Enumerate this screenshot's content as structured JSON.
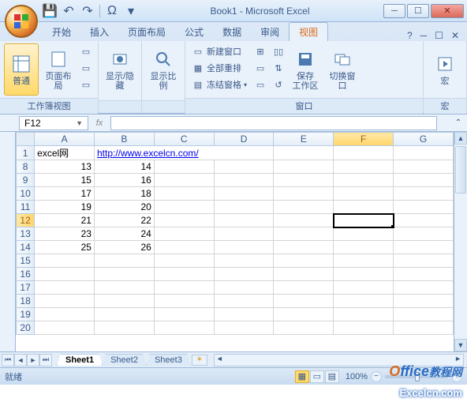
{
  "window": {
    "title": "Book1 - Microsoft Excel"
  },
  "qat": {
    "save": "💾",
    "undo": "↶",
    "redo": "↷",
    "omega": "Ω"
  },
  "tabs": {
    "items": [
      "开始",
      "插入",
      "页面布局",
      "公式",
      "数据",
      "审阅",
      "视图"
    ],
    "active": 6,
    "help": "?"
  },
  "ribbon": {
    "group1_label": "工作簿视图",
    "group2_label": "窗口",
    "group3_label": "宏",
    "normal": "普通",
    "page_layout": "页面布局",
    "show_hide": "显示/隐藏",
    "zoom": "显示比例",
    "new_window": "新建窗口",
    "arrange_all": "全部重排",
    "freeze": "冻结窗格",
    "save_workspace": "保存\n工作区",
    "switch_window": "切换窗口",
    "macros": "宏"
  },
  "namebox": "F12",
  "columns": [
    "A",
    "B",
    "C",
    "D",
    "E",
    "F",
    "G"
  ],
  "rows": [
    {
      "h": "1",
      "cells": [
        "excel网",
        "http://www.excelcn.com/",
        "",
        "",
        "",
        "",
        ""
      ],
      "text": [
        0
      ],
      "link": [
        1
      ],
      "linkspan": 3
    },
    {
      "h": "8",
      "cells": [
        "13",
        "14",
        "",
        "",
        "",
        "",
        ""
      ]
    },
    {
      "h": "9",
      "cells": [
        "15",
        "16",
        "",
        "",
        "",
        "",
        ""
      ]
    },
    {
      "h": "10",
      "cells": [
        "17",
        "18",
        "",
        "",
        "",
        "",
        ""
      ]
    },
    {
      "h": "11",
      "cells": [
        "19",
        "20",
        "",
        "",
        "",
        "",
        ""
      ]
    },
    {
      "h": "12",
      "cells": [
        "21",
        "22",
        "",
        "",
        "",
        "",
        ""
      ],
      "active": true
    },
    {
      "h": "13",
      "cells": [
        "23",
        "24",
        "",
        "",
        "",
        "",
        ""
      ]
    },
    {
      "h": "14",
      "cells": [
        "25",
        "26",
        "",
        "",
        "",
        "",
        ""
      ]
    },
    {
      "h": "15",
      "cells": [
        "",
        "",
        "",
        "",
        "",
        "",
        ""
      ]
    },
    {
      "h": "16",
      "cells": [
        "",
        "",
        "",
        "",
        "",
        "",
        ""
      ]
    },
    {
      "h": "17",
      "cells": [
        "",
        "",
        "",
        "",
        "",
        "",
        ""
      ]
    },
    {
      "h": "18",
      "cells": [
        "",
        "",
        "",
        "",
        "",
        "",
        ""
      ]
    },
    {
      "h": "19",
      "cells": [
        "",
        "",
        "",
        "",
        "",
        "",
        ""
      ]
    },
    {
      "h": "20",
      "cells": [
        "",
        "",
        "",
        "",
        "",
        "",
        ""
      ]
    }
  ],
  "active_col": 5,
  "sheets": {
    "items": [
      "Sheet1",
      "Sheet2",
      "Sheet3"
    ],
    "active": 0
  },
  "status": {
    "ready": "就绪",
    "zoom": "100%"
  },
  "watermark": {
    "brand_o": "O",
    "brand_ffice": "ffice",
    "brand_sub": "教程网",
    "url": "Excelcn.com"
  }
}
